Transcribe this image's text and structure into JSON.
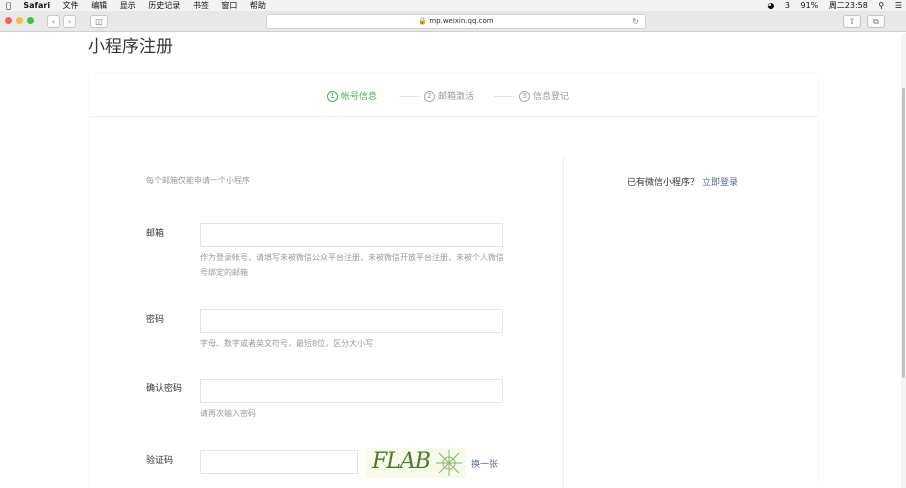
{
  "menubar": {
    "apple_icon": "apple-icon",
    "app": "Safari",
    "menus": [
      "文件",
      "编辑",
      "显示",
      "历史记录",
      "书签",
      "窗口",
      "帮助"
    ],
    "status": {
      "battery": "91%",
      "clock": "周二23:58",
      "ime": "3"
    }
  },
  "toolbar": {
    "url": "mp.weixin.qq.com",
    "back_icon": "chevron-left-icon",
    "forward_icon": "chevron-right-icon"
  },
  "page": {
    "title": "小程序注册"
  },
  "steps": [
    {
      "num": "1",
      "label": "帐号信息",
      "active": true
    },
    {
      "num": "2",
      "label": "邮箱激活",
      "active": false
    },
    {
      "num": "3",
      "label": "信息登记",
      "active": false
    }
  ],
  "form": {
    "intro": "每个邮箱仅能申请一个小程序",
    "email_label": "邮箱",
    "email_tip": "作为登录帐号，请填写未被微信公众平台注册，未被微信开放平台注册，未被个人微信号绑定的邮箱",
    "password_label": "密码",
    "password_tip": "字母、数字或者英文符号，最短8位，区分大小写",
    "confirm_label": "确认密码",
    "confirm_tip": "请再次输入密码",
    "captcha_label": "验证码",
    "captcha_text": "FLAB",
    "captcha_swap": "换一张"
  },
  "sidebar": {
    "hint": "已有微信小程序？",
    "login_link": "立即登录"
  },
  "colors": {
    "accent_green": "#44b549",
    "link_blue": "#576b95"
  }
}
